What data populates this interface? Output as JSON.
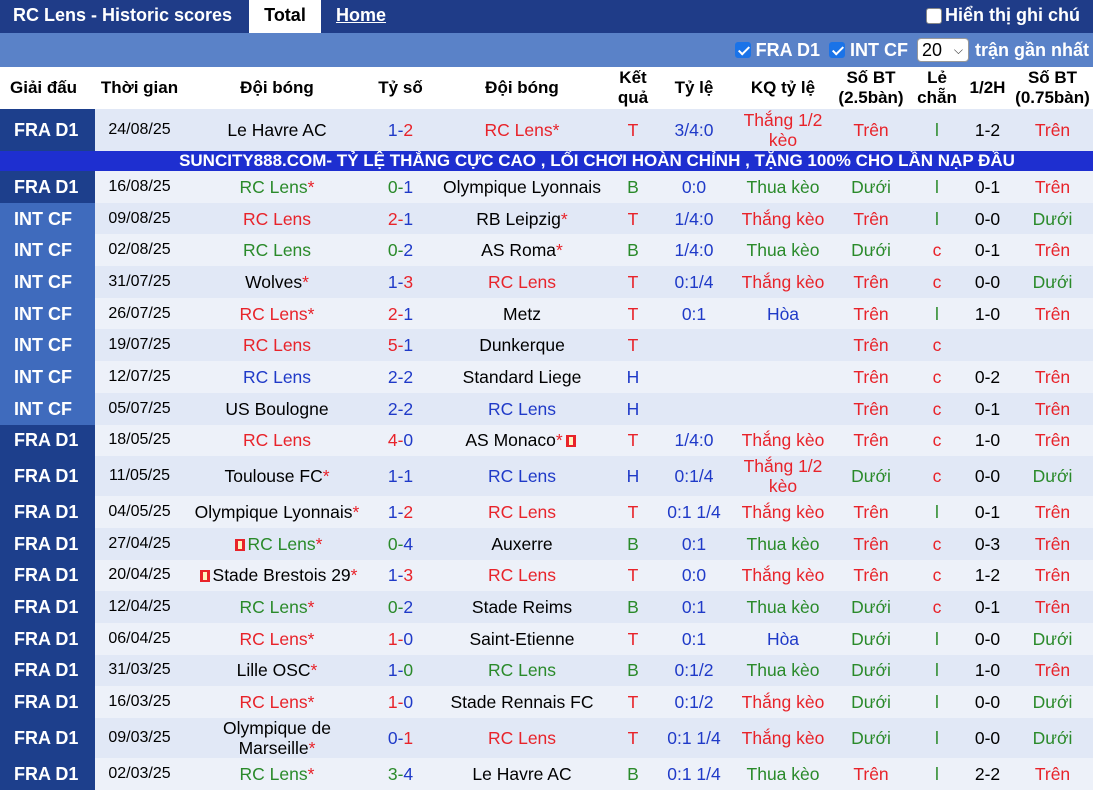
{
  "header": {
    "title": "RC Lens - Historic scores",
    "tab_total": "Total",
    "tab_home": "Home",
    "note_label": "Hiển thị ghi chú"
  },
  "filters": {
    "fra": "FRA D1",
    "int": "INT CF",
    "count": "20",
    "count_suffix": "trận gần nhất"
  },
  "columns": [
    "Giải đấu",
    "Thời gian",
    "Đội bóng",
    "Tỷ số",
    "Đội bóng",
    "Kết quả",
    "Tỷ lệ",
    "KQ tỷ lệ",
    "Số BT (2.5bàn)",
    "Lẻ chẵn",
    "1/2H",
    "Số BT (0.75bàn)"
  ],
  "ad_text": "SUNCITY888.COM- TỶ LỆ THẮNG CỰC CAO , LỐI CHƠI HOÀN CHỈNH , TẶNG 100% CHO LẦN NẠP ĐẦU",
  "colors": {
    "accent": "#1f3c88",
    "filter_bar": "#5a82c8",
    "win": "#e8232a",
    "loss": "#2a8a2a",
    "draw": "#1f3ac8"
  },
  "rows": [
    {
      "league": "FRA D1",
      "date": "24/08/25",
      "home": "Le Havre AC",
      "home_star": "",
      "score_a": "1",
      "score_b": "2",
      "away": "RC Lens",
      "away_star": "*",
      "res": "T",
      "odds": "3/4:0",
      "kq": "Thắng 1/2 kèo",
      "bt25": "Trên",
      "lc": "l",
      "h1": "1-2",
      "bt075": "Trên"
    },
    {
      "league": "FRA D1",
      "date": "16/08/25",
      "home": "RC Lens",
      "home_star": "*",
      "score_a": "0",
      "score_b": "1",
      "away": "Olympique Lyonnais",
      "away_star": "",
      "res": "B",
      "odds": "0:0",
      "kq": "Thua kèo",
      "bt25": "Dưới",
      "lc": "l",
      "h1": "0-1",
      "bt075": "Trên"
    },
    {
      "league": "INT CF",
      "date": "09/08/25",
      "home": "RC Lens",
      "home_star": "",
      "score_a": "2",
      "score_b": "1",
      "away": "RB Leipzig",
      "away_star": "*",
      "res": "T",
      "odds": "1/4:0",
      "kq": "Thắng kèo",
      "bt25": "Trên",
      "lc": "l",
      "h1": "0-0",
      "bt075": "Dưới"
    },
    {
      "league": "INT CF",
      "date": "02/08/25",
      "home": "RC Lens",
      "home_star": "",
      "score_a": "0",
      "score_b": "2",
      "away": "AS Roma",
      "away_star": "*",
      "res": "B",
      "odds": "1/4:0",
      "kq": "Thua kèo",
      "bt25": "Dưới",
      "lc": "c",
      "h1": "0-1",
      "bt075": "Trên"
    },
    {
      "league": "INT CF",
      "date": "31/07/25",
      "home": "Wolves",
      "home_star": "*",
      "score_a": "1",
      "score_b": "3",
      "away": "RC Lens",
      "away_star": "",
      "res": "T",
      "odds": "0:1/4",
      "kq": "Thắng kèo",
      "bt25": "Trên",
      "lc": "c",
      "h1": "0-0",
      "bt075": "Dưới"
    },
    {
      "league": "INT CF",
      "date": "26/07/25",
      "home": "RC Lens",
      "home_star": "*",
      "score_a": "2",
      "score_b": "1",
      "away": "Metz",
      "away_star": "",
      "res": "T",
      "odds": "0:1",
      "kq": "Hòa",
      "bt25": "Trên",
      "lc": "l",
      "h1": "1-0",
      "bt075": "Trên"
    },
    {
      "league": "INT CF",
      "date": "19/07/25",
      "home": "RC Lens",
      "home_star": "",
      "score_a": "5",
      "score_b": "1",
      "away": "Dunkerque",
      "away_star": "",
      "res": "T",
      "odds": "",
      "kq": "",
      "bt25": "Trên",
      "lc": "c",
      "h1": "",
      "bt075": ""
    },
    {
      "league": "INT CF",
      "date": "12/07/25",
      "home": "RC Lens",
      "home_star": "",
      "score_a": "2",
      "score_b": "2",
      "away": "Standard Liege",
      "away_star": "",
      "res": "H",
      "odds": "",
      "kq": "",
      "bt25": "Trên",
      "lc": "c",
      "h1": "0-2",
      "bt075": "Trên"
    },
    {
      "league": "INT CF",
      "date": "05/07/25",
      "home": "US Boulogne",
      "home_star": "",
      "score_a": "2",
      "score_b": "2",
      "away": "RC Lens",
      "away_star": "",
      "res": "H",
      "odds": "",
      "kq": "",
      "bt25": "Trên",
      "lc": "c",
      "h1": "0-1",
      "bt075": "Trên"
    },
    {
      "league": "FRA D1",
      "date": "18/05/25",
      "home": "RC Lens",
      "home_star": "",
      "score_a": "4",
      "score_b": "0",
      "away": "AS Monaco",
      "away_star": "*",
      "res": "T",
      "odds": "1/4:0",
      "kq": "Thắng kèo",
      "bt25": "Trên",
      "lc": "c",
      "h1": "1-0",
      "bt075": "Trên"
    },
    {
      "league": "FRA D1",
      "date": "11/05/25",
      "home": "Toulouse FC",
      "home_star": "*",
      "score_a": "1",
      "score_b": "1",
      "away": "RC Lens",
      "away_star": "",
      "res": "H",
      "odds": "0:1/4",
      "kq": "Thắng 1/2 kèo",
      "bt25": "Dưới",
      "lc": "c",
      "h1": "0-0",
      "bt075": "Dưới"
    },
    {
      "league": "FRA D1",
      "date": "04/05/25",
      "home": "Olympique Lyonnais",
      "home_star": "*",
      "score_a": "1",
      "score_b": "2",
      "away": "RC Lens",
      "away_star": "",
      "res": "T",
      "odds": "0:1 1/4",
      "kq": "Thắng kèo",
      "bt25": "Trên",
      "lc": "l",
      "h1": "0-1",
      "bt075": "Trên"
    },
    {
      "league": "FRA D1",
      "date": "27/04/25",
      "home": "RC Lens",
      "home_star": "*",
      "score_a": "0",
      "score_b": "4",
      "away": "Auxerre",
      "away_star": "",
      "res": "B",
      "odds": "0:1",
      "kq": "Thua kèo",
      "bt25": "Trên",
      "lc": "c",
      "h1": "0-3",
      "bt075": "Trên"
    },
    {
      "league": "FRA D1",
      "date": "20/04/25",
      "home": "Stade Brestois 29",
      "home_star": "*",
      "score_a": "1",
      "score_b": "3",
      "away": "RC Lens",
      "away_star": "",
      "res": "T",
      "odds": "0:0",
      "kq": "Thắng kèo",
      "bt25": "Trên",
      "lc": "c",
      "h1": "1-2",
      "bt075": "Trên"
    },
    {
      "league": "FRA D1",
      "date": "12/04/25",
      "home": "RC Lens",
      "home_star": "*",
      "score_a": "0",
      "score_b": "2",
      "away": "Stade Reims",
      "away_star": "",
      "res": "B",
      "odds": "0:1",
      "kq": "Thua kèo",
      "bt25": "Dưới",
      "lc": "c",
      "h1": "0-1",
      "bt075": "Trên"
    },
    {
      "league": "FRA D1",
      "date": "06/04/25",
      "home": "RC Lens",
      "home_star": "*",
      "score_a": "1",
      "score_b": "0",
      "away": "Saint-Etienne",
      "away_star": "",
      "res": "T",
      "odds": "0:1",
      "kq": "Hòa",
      "bt25": "Dưới",
      "lc": "l",
      "h1": "0-0",
      "bt075": "Dưới"
    },
    {
      "league": "FRA D1",
      "date": "31/03/25",
      "home": "Lille OSC",
      "home_star": "*",
      "score_a": "1",
      "score_b": "0",
      "away": "RC Lens",
      "away_star": "",
      "res": "B",
      "odds": "0:1/2",
      "kq": "Thua kèo",
      "bt25": "Dưới",
      "lc": "l",
      "h1": "1-0",
      "bt075": "Trên"
    },
    {
      "league": "FRA D1",
      "date": "16/03/25",
      "home": "RC Lens",
      "home_star": "*",
      "score_a": "1",
      "score_b": "0",
      "away": "Stade Rennais FC",
      "away_star": "",
      "res": "T",
      "odds": "0:1/2",
      "kq": "Thắng kèo",
      "bt25": "Dưới",
      "lc": "l",
      "h1": "0-0",
      "bt075": "Dưới"
    },
    {
      "league": "FRA D1",
      "date": "09/03/25",
      "home": "Olympique de Marseille",
      "home_star": "*",
      "score_a": "0",
      "score_b": "1",
      "away": "RC Lens",
      "away_star": "",
      "res": "T",
      "odds": "0:1 1/4",
      "kq": "Thắng kèo",
      "bt25": "Dưới",
      "lc": "l",
      "h1": "0-0",
      "bt075": "Dưới"
    },
    {
      "league": "FRA D1",
      "date": "02/03/25",
      "home": "RC Lens",
      "home_star": "*",
      "score_a": "3",
      "score_b": "4",
      "away": "Le Havre AC",
      "away_star": "",
      "res": "B",
      "odds": "0:1 1/4",
      "kq": "Thua kèo",
      "bt25": "Trên",
      "lc": "l",
      "h1": "2-2",
      "bt075": "Trên"
    }
  ]
}
